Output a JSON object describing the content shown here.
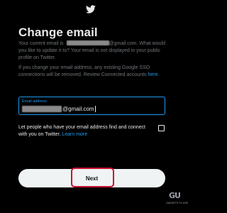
{
  "header": {
    "logo_icon": "twitter-bird-icon"
  },
  "page": {
    "title": "Change email"
  },
  "info": {
    "current_prefix": "Your current email is ",
    "current_suffix": "@gmail.com. What would you like to update it to? Your email is not displayed in your public profile on Twitter.",
    "sso_text": "If you change your email address, any existing Google SSO connections will be removed. Review Connected accounts ",
    "sso_link": "here",
    "sso_end": "."
  },
  "email_field": {
    "label": "Email address",
    "value_suffix": "@gmail.com"
  },
  "discoverability": {
    "text": "Let people who have your email address find and connect with you on Twitter. ",
    "link": "Learn more"
  },
  "actions": {
    "next_label": "Next"
  },
  "watermark": {
    "logo": "GU",
    "text": "GADGETS TO USE"
  },
  "colors": {
    "accent": "#1d9bf0",
    "background": "#000000",
    "button": "#eff3f4",
    "highlight": "#c8102e"
  }
}
